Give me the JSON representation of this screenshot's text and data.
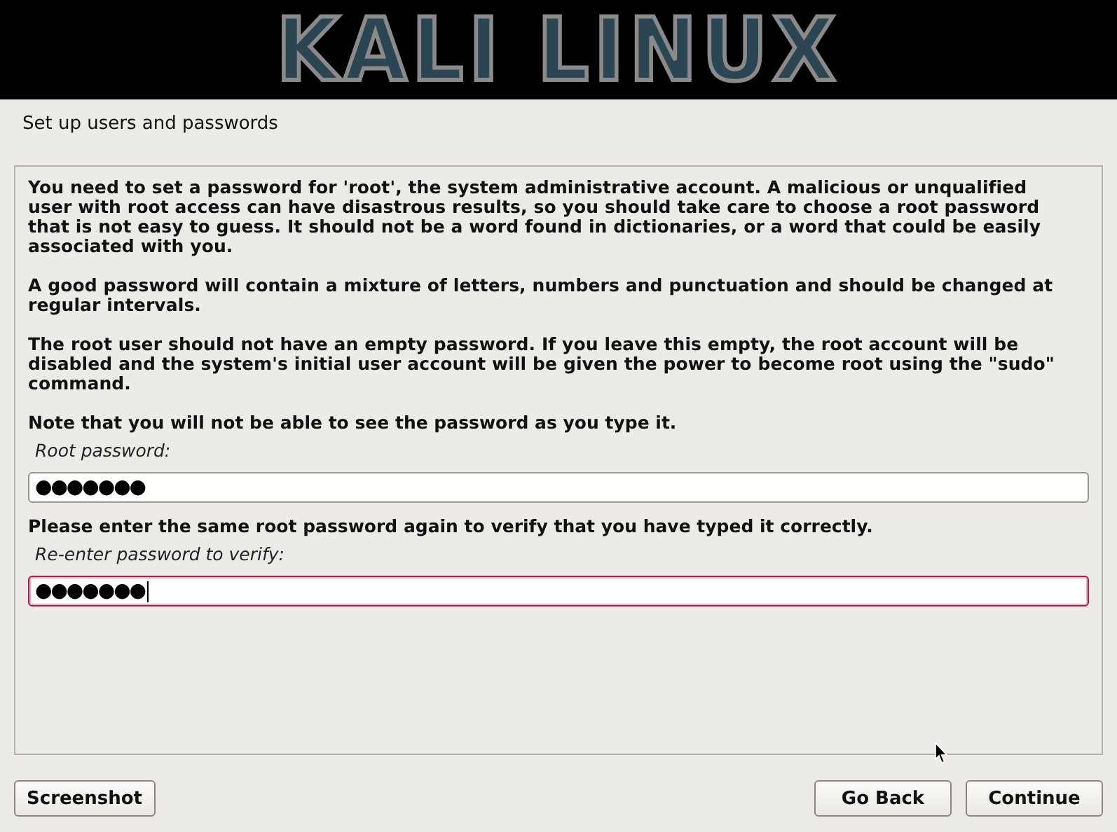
{
  "banner": {
    "logo": "KALI LINUX"
  },
  "step_title": "Set up users and passwords",
  "content": [
    {
      "kind": "paragraph",
      "text": "You need to set a password for 'root', the system administrative account. A malicious or unqualified user with root access can have disastrous results, so you should take care to choose a root password that is not easy to guess. It should not be a word found in dictionaries, or a word that could be easily associated with you."
    },
    {
      "kind": "paragraph",
      "text": "A good password will contain a mixture of letters, numbers and punctuation and should be changed at regular intervals."
    },
    {
      "kind": "paragraph",
      "text": "The root user should not have an empty password. If you leave this empty, the root account will be disabled and the system's initial user account will be given the power to become root using the \"sudo\" command."
    },
    {
      "kind": "note",
      "text": "Note that you will not be able to see the password as you type it."
    },
    {
      "kind": "field",
      "label": "Root password:",
      "value": "●●●●●●●",
      "focused": false
    },
    {
      "kind": "note",
      "text": "Please enter the same root password again to verify that you have typed it correctly."
    },
    {
      "kind": "field",
      "label": "Re-enter password to verify:",
      "value": "●●●●●●●",
      "focused": true
    }
  ],
  "buttons": {
    "left": [
      "Screenshot"
    ],
    "right": [
      "Go Back",
      "Continue"
    ]
  }
}
